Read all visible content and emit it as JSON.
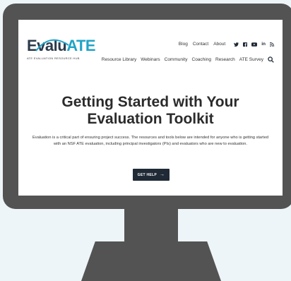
{
  "site": {
    "logo_text_1": "Evalu",
    "logo_text_2": "ATE",
    "logo_subtitle": "ATE EVALUATION RESOURCE HUB"
  },
  "nav_top": {
    "items": [
      "Blog",
      "Contact",
      "About"
    ],
    "social_icons": [
      "twitter-icon",
      "facebook-icon",
      "youtube-icon",
      "linkedin-icon",
      "rss-icon"
    ]
  },
  "nav_main": {
    "items": [
      "Resource Library",
      "Webinars",
      "Community",
      "Coaching",
      "Research",
      "ATE Survey"
    ]
  },
  "hero": {
    "title": "Getting Started with Your Evaluation Toolkit",
    "body": "Evaluation is a critical part of ensuring project success. The resources and tools below are intended for anyone who is getting started with an NSF ATE evaluation, including principal investigators (PIs) and evaluators who are new to evaluation.",
    "cta_label": "GET HELP"
  },
  "colors": {
    "accent": "#20a4c7",
    "dark": "#1f2a36",
    "monitor": "#535353",
    "background": "#eef5f8"
  }
}
